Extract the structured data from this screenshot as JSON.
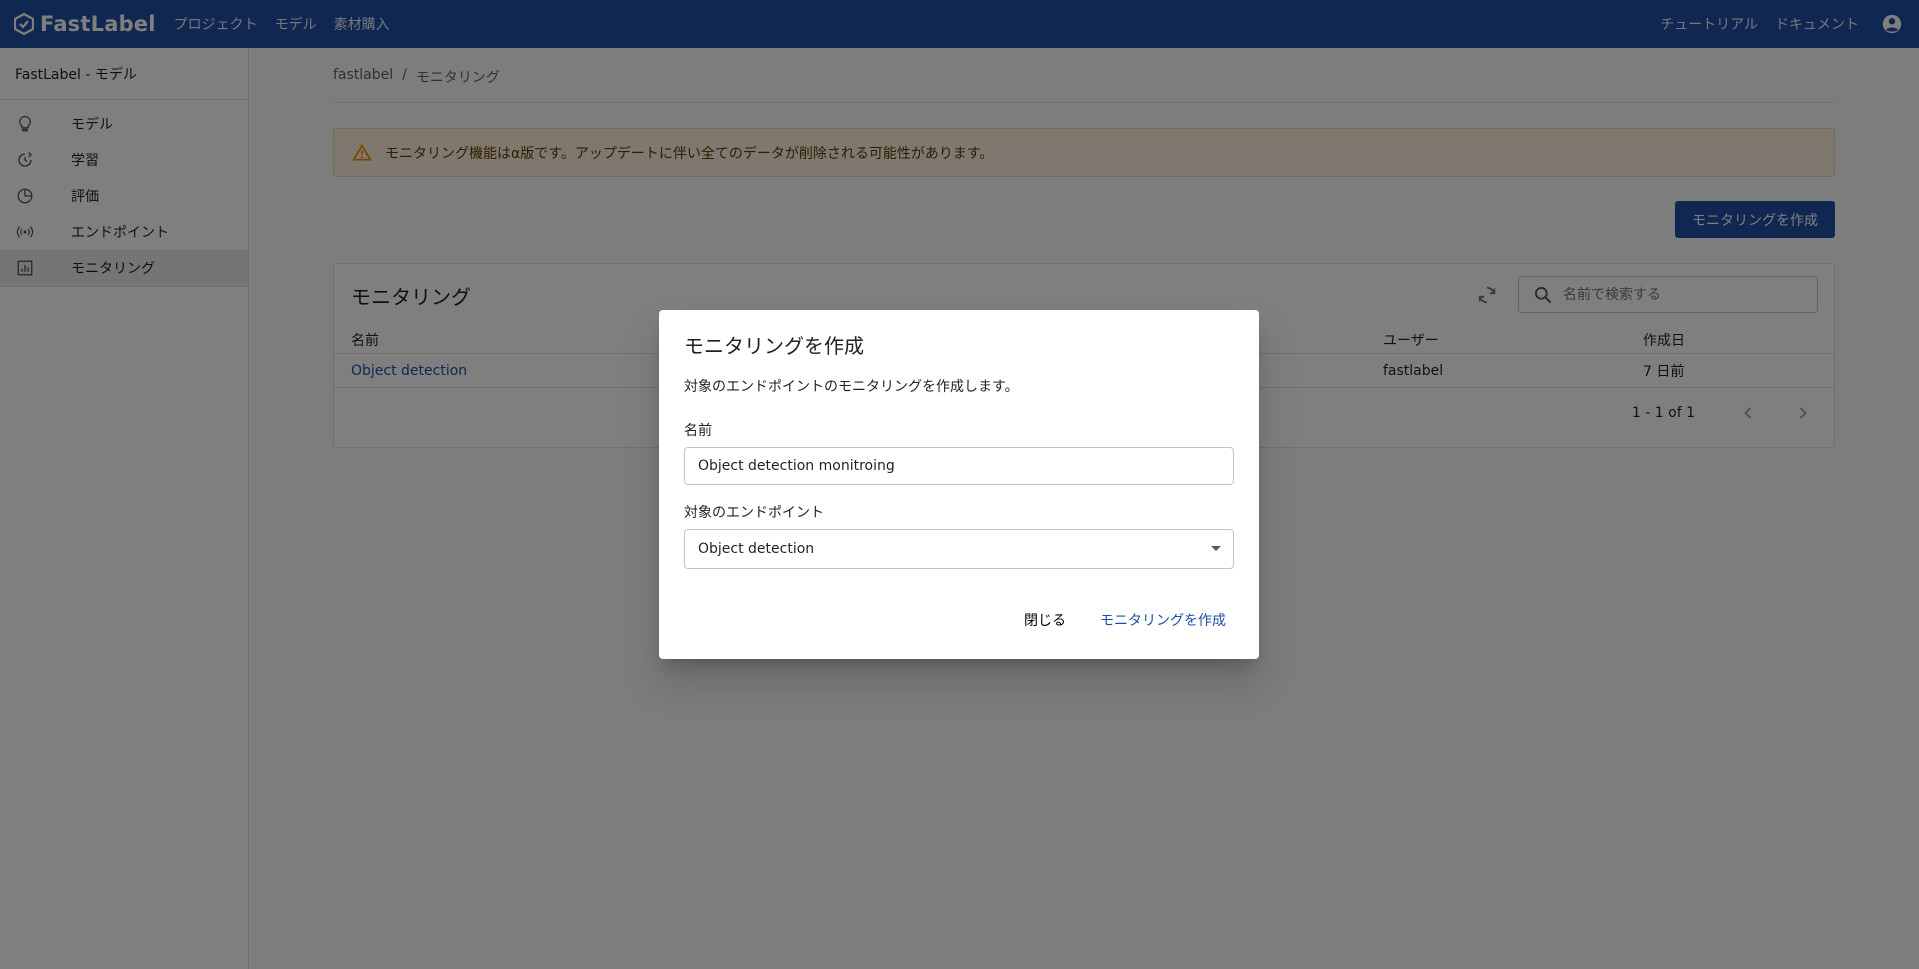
{
  "topbar": {
    "brand": "FastLabel",
    "nav": [
      "プロジェクト",
      "モデル",
      "素材購入"
    ],
    "right_links": [
      "チュートリアル",
      "ドキュメント"
    ],
    "color": "#1f4fa3"
  },
  "sidebar": {
    "title": "FastLabel - モデル",
    "items": [
      {
        "label": "モデル",
        "icon": "lightbulb-icon"
      },
      {
        "label": "学習",
        "icon": "training-icon"
      },
      {
        "label": "評価",
        "icon": "pie-chart-icon"
      },
      {
        "label": "エンドポイント",
        "icon": "broadcast-icon"
      },
      {
        "label": "モニタリング",
        "icon": "monitoring-icon"
      }
    ],
    "active": "モニタリング"
  },
  "breadcrumb": [
    "fastlabel",
    "モニタリング"
  ],
  "alert": {
    "text": "モニタリング機能はα版です。アップデートに伴い全てのデータが削除される可能性があります。"
  },
  "create_button": "モニタリングを作成",
  "card": {
    "title": "モニタリング",
    "search_placeholder": "名前で検索する",
    "columns": {
      "name": "名前",
      "user": "ユーザー",
      "created": "作成日"
    },
    "rows": [
      {
        "name": "Object detection",
        "user": "fastlabel",
        "created": "7 日前"
      }
    ],
    "pagination": "1 - 1 of 1"
  },
  "dialog": {
    "title": "モニタリングを作成",
    "description": "対象のエンドポイントのモニタリングを作成します。",
    "name_label": "名前",
    "name_value": "Object detection monitroing",
    "endpoint_label": "対象のエンドポイント",
    "endpoint_value": "Object detection",
    "close_button": "閉じる",
    "submit_button": "モニタリングを作成"
  }
}
